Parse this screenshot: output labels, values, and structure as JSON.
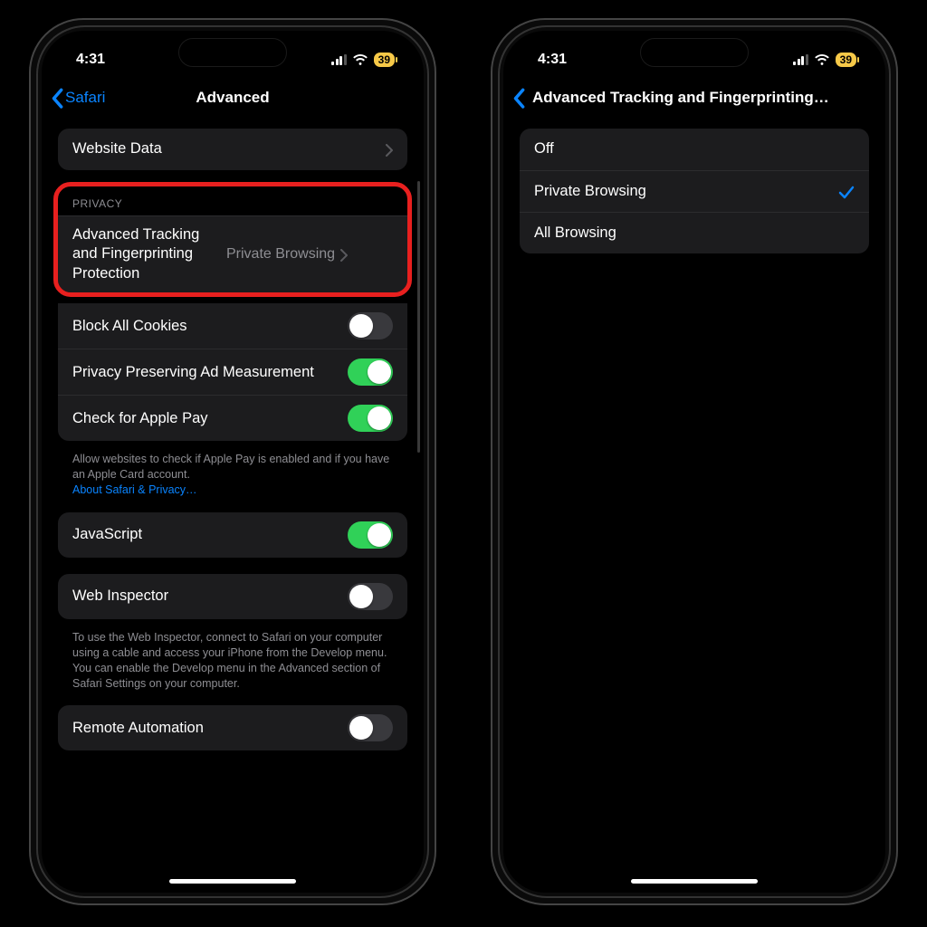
{
  "status": {
    "time": "4:31",
    "battery": "39"
  },
  "left": {
    "back_label": "Safari",
    "title": "Advanced",
    "website_data": "Website Data",
    "privacy_header": "PRIVACY",
    "tracking": {
      "label": "Advanced Tracking and Fingerprinting Protection",
      "value": "Private Browsing"
    },
    "block_cookies": "Block All Cookies",
    "ppam": "Privacy Preserving Ad Measurement",
    "apple_pay": "Check for Apple Pay",
    "apple_pay_footer": "Allow websites to check if Apple Pay is enabled and if you have an Apple Card account.",
    "apple_pay_link": "About Safari & Privacy…",
    "javascript": "JavaScript",
    "web_inspector": "Web Inspector",
    "web_inspector_footer": "To use the Web Inspector, connect to Safari on your computer using a cable and access your iPhone from the Develop menu. You can enable the Develop menu in the Advanced section of Safari Settings on your computer.",
    "remote_automation": "Remote Automation",
    "toggles": {
      "block_cookies": false,
      "ppam": true,
      "apple_pay": true,
      "javascript": true,
      "web_inspector": false,
      "remote_automation": false
    }
  },
  "right": {
    "title": "Advanced Tracking and Fingerprinting…",
    "options": {
      "off": "Off",
      "private": "Private Browsing",
      "all": "All Browsing"
    },
    "selected": "private"
  },
  "colors": {
    "accent": "#0a84ff",
    "toggle_on": "#30d158",
    "highlight": "#e8201f",
    "battery": "#f7c948"
  }
}
